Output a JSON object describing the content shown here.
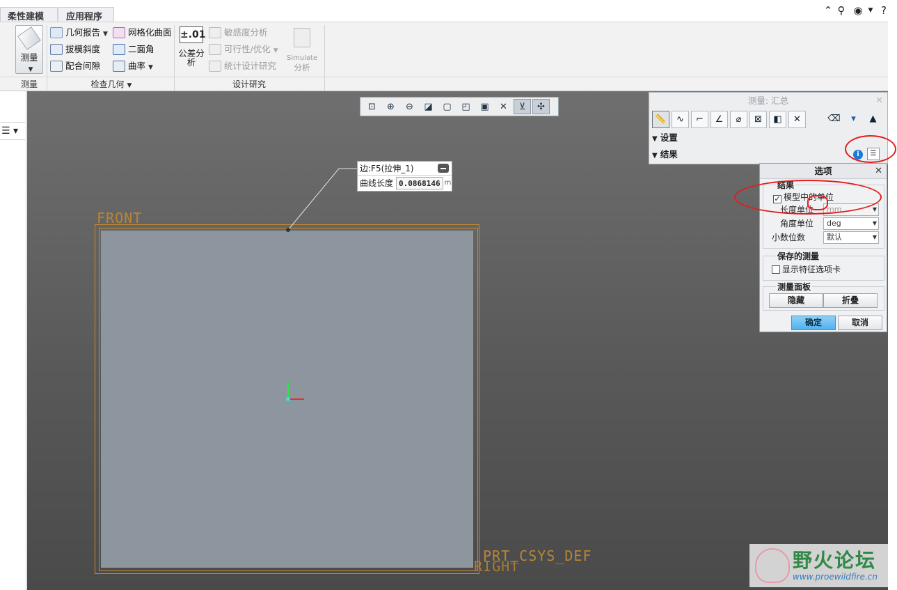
{
  "tabs": [
    {
      "label": "柔性建模"
    },
    {
      "label": "应用程序"
    }
  ],
  "ribbon": {
    "measure_label": "测量",
    "tolerance_big": "±.01",
    "tolerance_label": "公差分析",
    "simulate_line1": "Simulate",
    "simulate_line2": "分析",
    "items": {
      "geometry_report": "几何报告",
      "mesh_surface": "网格化曲面",
      "draft": "拔模斜度",
      "dihedral": "二面角",
      "clearance": "配合间隙",
      "curvature": "曲率",
      "sensitivity": "敏感度分析",
      "feasibility": "可行性/优化",
      "stat_design": "统计设计研究"
    },
    "groups": {
      "measure": "测量",
      "inspect": "检查几何",
      "design_study": "设计研究"
    }
  },
  "callout": {
    "title": "边:F5(拉伸_1)",
    "label": "曲线长度",
    "value": "0.0868146",
    "unit": "m"
  },
  "datums": {
    "front": "FRONT",
    "csys": "PRT_CSYS_DEF",
    "right": "RIGHT"
  },
  "measure_panel": {
    "title": "测量: 汇总",
    "settings": "设置",
    "results": "结果"
  },
  "options": {
    "title": "选项",
    "results_legend": "结果",
    "model_units": "模型中的单位",
    "model_units_checked": true,
    "length_unit_label": "长度单位",
    "length_unit": "mm",
    "angle_unit_label": "角度单位",
    "angle_unit": "deg",
    "decimals_label": "小数位数",
    "decimals": "默认",
    "saved_legend": "保存的测量",
    "show_feature_tab": "显示特征选项卡",
    "show_feature_tab_checked": false,
    "panel_legend": "测量面板",
    "hide": "隐藏",
    "collapse": "折叠",
    "ok": "确定",
    "cancel": "取消"
  },
  "watermark": {
    "name": "野火论坛",
    "url": "www.proewildfire.cn"
  },
  "colors": {
    "datum": "#c98a2c",
    "annotation": "#e51b1b",
    "ok_button": "#4fb2ee"
  }
}
